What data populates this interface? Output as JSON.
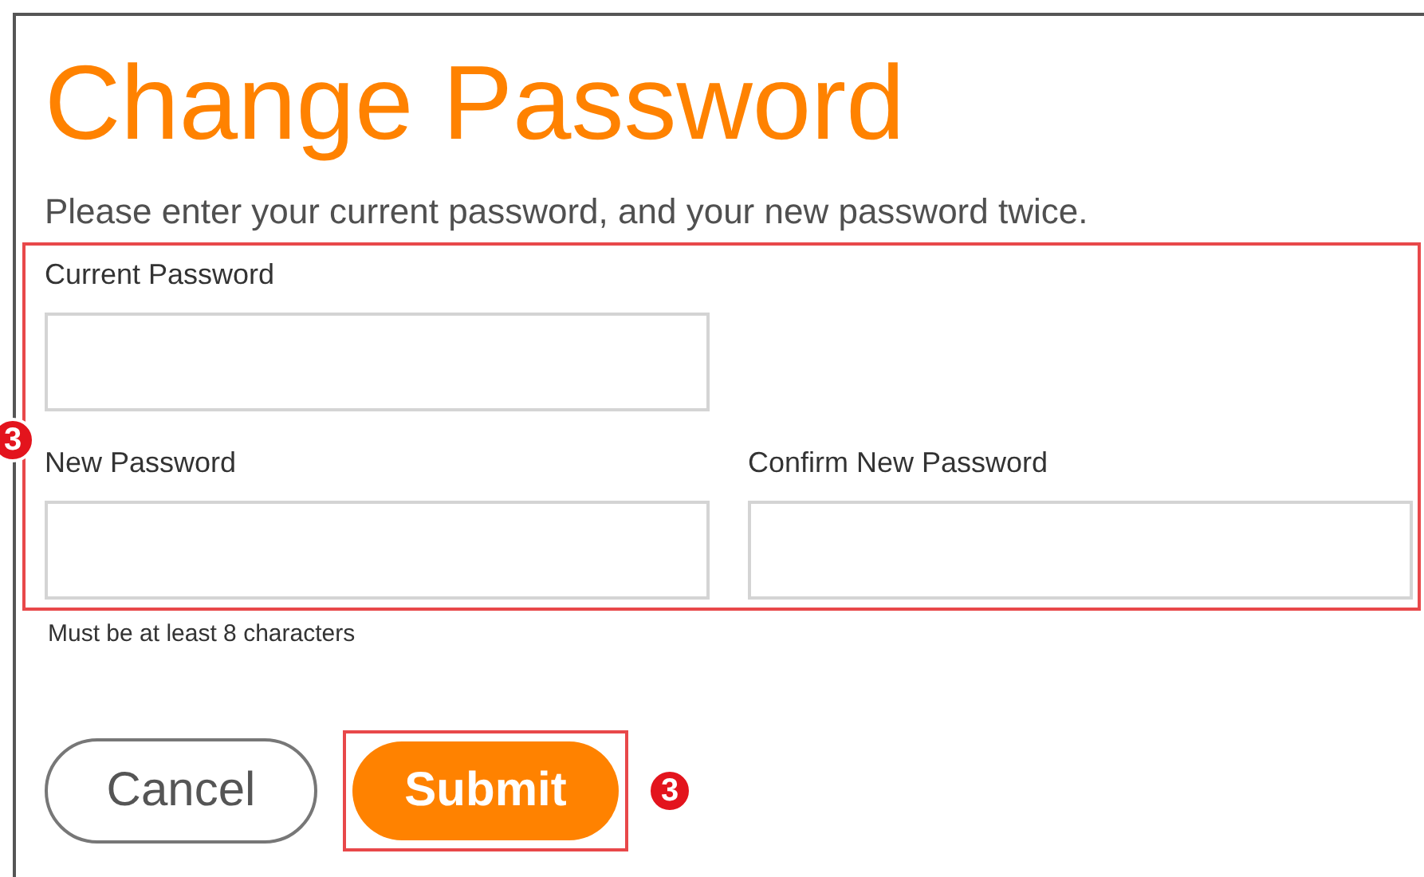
{
  "title": "Change Password",
  "instruction": "Please enter your current password, and your new password twice.",
  "field_group_badge": "3",
  "fields": [
    {
      "label": "Current Password"
    },
    {
      "label": "New Password"
    },
    {
      "label": "Confirm New Password"
    }
  ],
  "hint": "Must be at least 8 characters",
  "buttons": [
    {
      "label": "Cancel",
      "kind": "secondary"
    },
    {
      "label": "Submit",
      "kind": "primary",
      "badge": "3"
    }
  ]
}
